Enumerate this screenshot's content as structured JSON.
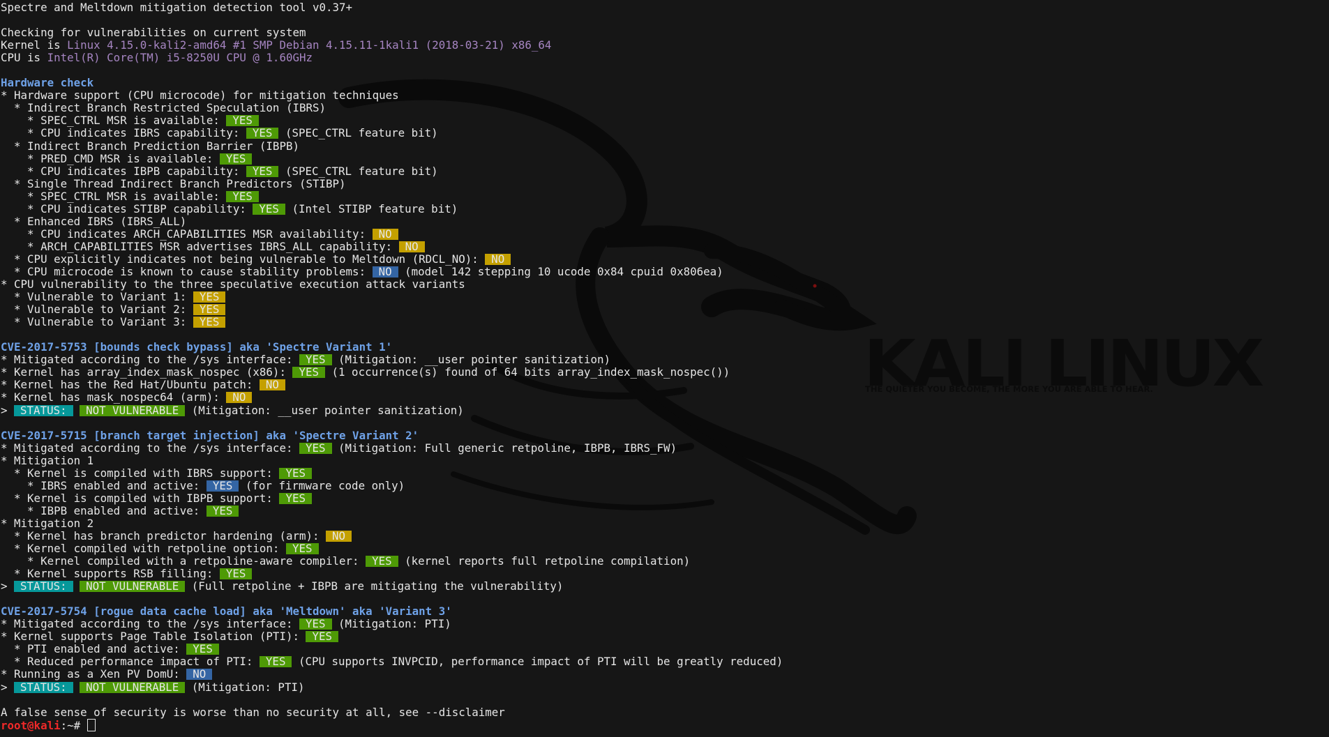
{
  "wallpaper": {
    "logo_text": "KALI LINUX",
    "tagline": "THE QUIETER YOU BECOME, THE MORE YOU ARE ABLE TO HEAR.",
    "background_color": "#161616"
  },
  "colors": {
    "yes_green": "#4e9a06",
    "no_yellow": "#c4a000",
    "info_blue": "#3465a4",
    "status_cyan": "#06989a",
    "heading_blue": "#6fa2e8",
    "prompt_red": "#ef2929",
    "version_purple": "#a685c2"
  },
  "terminal": {
    "title_line": "Spectre and Meltdown mitigation detection tool v0.37+",
    "checking": "Checking for vulnerabilities on current system",
    "kernel_label": "Kernel is ",
    "kernel_value": "Linux 4.15.0-kali2-amd64 #1 SMP Debian 4.15.11-1kali1 (2018-03-21) x86_64",
    "cpu_label": "CPU is ",
    "cpu_value": "Intel(R) Core(TM) i5-8250U CPU @ 1.60GHz",
    "hw": {
      "heading": "Hardware check",
      "l1": "* Hardware support (CPU microcode) for mitigation techniques",
      "l2": "  * Indirect Branch Restricted Speculation (IBRS)",
      "l3": "    * SPEC_CTRL MSR is available: ",
      "l4": "    * CPU indicates IBRS capability: ",
      "l4s": " (SPEC_CTRL feature bit)",
      "l5": "  * Indirect Branch Prediction Barrier (IBPB)",
      "l6": "    * PRED_CMD MSR is available: ",
      "l7": "    * CPU indicates IBPB capability: ",
      "l7s": " (SPEC_CTRL feature bit)",
      "l8": "  * Single Thread Indirect Branch Predictors (STIBP)",
      "l9": "    * SPEC_CTRL MSR is available: ",
      "l10": "    * CPU indicates STIBP capability: ",
      "l10s": " (Intel STIBP feature bit)",
      "l11": "  * Enhanced IBRS (IBRS_ALL)",
      "l12": "    * CPU indicates ARCH_CAPABILITIES MSR availability: ",
      "l13": "    * ARCH_CAPABILITIES MSR advertises IBRS_ALL capability: ",
      "l14": "  * CPU explicitly indicates not being vulnerable to Meltdown (RDCL_NO): ",
      "l15": "  * CPU microcode is known to cause stability problems: ",
      "l15s": " (model 142 stepping 10 ucode 0x84 cpuid 0x806ea)",
      "l16": "* CPU vulnerability to the three speculative execution attack variants",
      "l17": "  * Vulnerable to Variant 1: ",
      "l18": "  * Vulnerable to Variant 2: ",
      "l19": "  * Vulnerable to Variant 3: "
    },
    "v1": {
      "heading": "CVE-2017-5753 [bounds check bypass] aka 'Spectre Variant 1'",
      "l1": "* Mitigated according to the /sys interface: ",
      "l1s": " (Mitigation: __user pointer sanitization)",
      "l2": "* Kernel has array_index_mask_nospec (x86): ",
      "l2s": " (1 occurrence(s) found of 64 bits array_index_mask_nospec())",
      "l3": "* Kernel has the Red Hat/Ubuntu patch: ",
      "l4": "* Kernel has mask_nospec64 (arm): ",
      "status_s": " (Mitigation: __user pointer sanitization)"
    },
    "v2": {
      "heading": "CVE-2017-5715 [branch target injection] aka 'Spectre Variant 2'",
      "l1": "* Mitigated according to the /sys interface: ",
      "l1s": " (Mitigation: Full generic retpoline, IBPB, IBRS_FW)",
      "l2": "* Mitigation 1",
      "l3": "  * Kernel is compiled with IBRS support: ",
      "l4": "    * IBRS enabled and active: ",
      "l4s": " (for firmware code only)",
      "l5": "  * Kernel is compiled with IBPB support: ",
      "l6": "    * IBPB enabled and active: ",
      "l7": "* Mitigation 2",
      "l8": "  * Kernel has branch predictor hardening (arm): ",
      "l9": "  * Kernel compiled with retpoline option: ",
      "l10": "    * Kernel compiled with a retpoline-aware compiler: ",
      "l10s": " (kernel reports full retpoline compilation)",
      "l11": "  * Kernel supports RSB filling: ",
      "status_s": " (Full retpoline + IBPB are mitigating the vulnerability)"
    },
    "v3": {
      "heading": "CVE-2017-5754 [rogue data cache load] aka 'Meltdown' aka 'Variant 3'",
      "l1": "* Mitigated according to the /sys interface: ",
      "l1s": " (Mitigation: PTI)",
      "l2": "* Kernel supports Page Table Isolation (PTI): ",
      "l3": "  * PTI enabled and active: ",
      "l4": "  * Reduced performance impact of PTI: ",
      "l4s": " (CPU supports INVPCID, performance impact of PTI will be greatly reduced)",
      "l5": "* Running as a Xen PV DomU: ",
      "status_s": " (Mitigation: PTI)"
    },
    "badge_yes": "YES",
    "badge_no": "NO",
    "badge_status": "STATUS:",
    "badge_not_vuln": "NOT VULNERABLE",
    "status_prefix": "> ",
    "disclaimer": "A false sense of security is worse than no security at all, see --disclaimer",
    "prompt_user": "root@kali",
    "prompt_rest": ":~# "
  }
}
